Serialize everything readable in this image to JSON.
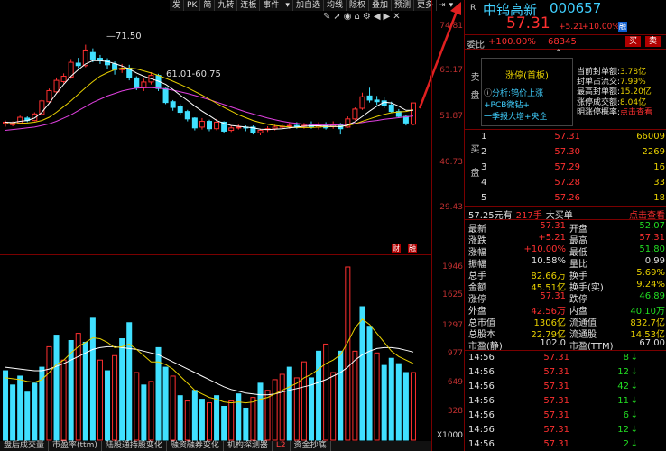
{
  "toolbar": {
    "items": [
      "发",
      "PK",
      "简",
      "九转",
      "连板",
      "事件",
      "▾",
      "加自选",
      "均线",
      "除权",
      "叠加",
      "预测",
      "更多",
      "⇥",
      "▾"
    ],
    "icons": [
      "tool-icon",
      "arrow-icon",
      "eye-icon",
      "home-icon",
      "gear-icon",
      "back-icon",
      "forward-icon",
      "close-icon"
    ]
  },
  "price_axis": [
    "74.81",
    "63.17",
    "51.87",
    "40.73",
    "29.43"
  ],
  "vol_axis": [
    "1946",
    "1625",
    "1297",
    "977",
    "649",
    "328",
    "X1000"
  ],
  "annotations": {
    "high": "71.50",
    "range": "61.01-60.75"
  },
  "bottom_tabs": [
    "盘后成交量",
    "市盈率(ttm)",
    "陆股通持股变化",
    "融资融券变化",
    "机构探测器",
    "L2",
    "资金抄底"
  ],
  "stock": {
    "name": "中钨高新",
    "code": "000657",
    "price": "57.31",
    "change": "+5.21",
    "pct": "+10.00%",
    "badge": "融",
    "r_label": "R",
    "weibi_label": "委比",
    "weibi_val": "+100.00%",
    "weicha": "68345",
    "buy": "买",
    "sell": "卖"
  },
  "limit": {
    "title": "涨停(首板)",
    "analysis_label": "分析:",
    "analysis_text": "钨价上涨",
    "tags": "+PCB微钻+",
    "tags2": "一季报大增+央企",
    "side_label": "卖盘",
    "stats": [
      {
        "k": "当前封单额:",
        "v": "3.78亿"
      },
      {
        "k": "封单占流交:",
        "v": "7.99%"
      },
      {
        "k": "最高封单额:",
        "v": "15.20亿"
      },
      {
        "k": "涨停成交额:",
        "v": "8.04亿"
      },
      {
        "k": "明涨停概率:",
        "v": "点击查看"
      }
    ]
  },
  "bids": {
    "label": "买盘",
    "rows": [
      {
        "lv": "1",
        "p": "57.31",
        "q": "66009"
      },
      {
        "lv": "2",
        "p": "57.30",
        "q": "2269"
      },
      {
        "lv": "3",
        "p": "57.29",
        "q": "16"
      },
      {
        "lv": "4",
        "p": "57.28",
        "q": "33"
      },
      {
        "lv": "5",
        "p": "57.26",
        "q": "18"
      }
    ]
  },
  "bigbuy": {
    "left": "57.25元有",
    "mid": "217手",
    "mid2": "大买单",
    "right": "点击查看"
  },
  "quote": [
    {
      "k1": "最新",
      "v1": "57.31",
      "k2": "开盘",
      "v2": "52.07"
    },
    {
      "k1": "涨跌",
      "v1": "+5.21",
      "k2": "最高",
      "v2": "57.31"
    },
    {
      "k1": "涨幅",
      "v1": "+10.00%",
      "k2": "最低",
      "v2": "51.80"
    },
    {
      "k1": "振幅",
      "v1": "10.58%",
      "k2": "量比",
      "v2": "0.99"
    },
    {
      "k1": "总手",
      "v1": "82.66万",
      "k2": "换手",
      "v2": "5.69%"
    },
    {
      "k1": "金额",
      "v1": "45.51亿",
      "k2": "换手(实)",
      "v2": "9.24%"
    },
    {
      "k1": "涨停",
      "v1": "57.31",
      "k2": "跌停",
      "v2": "46.89"
    },
    {
      "k1": "外盘",
      "v1": "42.56万",
      "k2": "内盘",
      "v2": "40.10万"
    },
    {
      "k1": "总市值",
      "v1": "1306亿",
      "k2": "流通值",
      "v2": "832.7亿"
    },
    {
      "k1": "总股本",
      "v1": "22.79亿",
      "k2": "流通股",
      "v2": "14.53亿"
    },
    {
      "k1": "市盈(静)",
      "v1": "102.0",
      "k2": "市盈(TTM)",
      "v2": "67.00"
    }
  ],
  "ticks": [
    {
      "t": "14:56",
      "p": "57.31",
      "q": "8",
      "d": "↓"
    },
    {
      "t": "14:56",
      "p": "57.31",
      "q": "12",
      "d": "↓"
    },
    {
      "t": "14:56",
      "p": "57.31",
      "q": "42",
      "d": "↓"
    },
    {
      "t": "14:56",
      "p": "57.31",
      "q": "11",
      "d": "↓"
    },
    {
      "t": "14:56",
      "p": "57.31",
      "q": "6",
      "d": "↓"
    },
    {
      "t": "14:56",
      "p": "57.31",
      "q": "12",
      "d": "↓"
    },
    {
      "t": "14:56",
      "p": "57.31",
      "q": "2",
      "d": "↓"
    }
  ],
  "chart_data": {
    "type": "candlestick",
    "ylim": [
      23,
      78
    ],
    "candles": [
      {
        "o": 52.3,
        "c": 52.6,
        "h": 53.0,
        "l": 51.5
      },
      {
        "o": 52.0,
        "c": 52.4,
        "h": 52.8,
        "l": 51.6
      },
      {
        "o": 52.4,
        "c": 53.8,
        "h": 54.2,
        "l": 52.1
      },
      {
        "o": 53.6,
        "c": 53.0,
        "h": 54.0,
        "l": 52.6
      },
      {
        "o": 53.0,
        "c": 54.6,
        "h": 55.0,
        "l": 52.8
      },
      {
        "o": 54.5,
        "c": 57.8,
        "h": 58.2,
        "l": 54.2
      },
      {
        "o": 57.6,
        "c": 60.3,
        "h": 60.8,
        "l": 57.2
      },
      {
        "o": 60.0,
        "c": 62.8,
        "h": 63.5,
        "l": 59.7
      },
      {
        "o": 62.5,
        "c": 63.8,
        "h": 64.5,
        "l": 62.0
      },
      {
        "o": 63.6,
        "c": 67.2,
        "h": 68.0,
        "l": 63.2
      },
      {
        "o": 67.0,
        "c": 66.4,
        "h": 68.3,
        "l": 65.8
      },
      {
        "o": 66.4,
        "c": 70.2,
        "h": 71.5,
        "l": 66.0
      },
      {
        "o": 69.6,
        "c": 68.0,
        "h": 70.6,
        "l": 67.2
      },
      {
        "o": 68.2,
        "c": 67.6,
        "h": 69.0,
        "l": 66.8
      },
      {
        "o": 67.6,
        "c": 66.6,
        "h": 68.2,
        "l": 65.6
      },
      {
        "o": 66.8,
        "c": 65.4,
        "h": 67.4,
        "l": 64.2
      },
      {
        "o": 65.4,
        "c": 65.7,
        "h": 66.8,
        "l": 64.6
      },
      {
        "o": 65.8,
        "c": 63.4,
        "h": 66.6,
        "l": 62.8
      },
      {
        "o": 63.4,
        "c": 61.0,
        "h": 63.8,
        "l": 60.4
      },
      {
        "o": 61.0,
        "c": 62.4,
        "h": 63.2,
        "l": 60.2
      },
      {
        "o": 62.4,
        "c": 64.0,
        "h": 64.8,
        "l": 61.8
      },
      {
        "o": 64.0,
        "c": 60.8,
        "h": 64.4,
        "l": 60.2
      },
      {
        "o": 60.8,
        "c": 57.4,
        "h": 61.0,
        "l": 57.0
      },
      {
        "o": 57.6,
        "c": 56.2,
        "h": 58.0,
        "l": 55.4
      },
      {
        "o": 56.4,
        "c": 55.0,
        "h": 57.0,
        "l": 54.4
      },
      {
        "o": 55.2,
        "c": 53.4,
        "h": 55.6,
        "l": 52.8
      },
      {
        "o": 53.6,
        "c": 51.2,
        "h": 53.8,
        "l": 50.6
      },
      {
        "o": 51.4,
        "c": 52.8,
        "h": 53.6,
        "l": 50.8
      },
      {
        "o": 52.8,
        "c": 51.0,
        "h": 53.2,
        "l": 50.4
      },
      {
        "o": 51.0,
        "c": 52.6,
        "h": 53.4,
        "l": 50.6
      },
      {
        "o": 52.6,
        "c": 50.4,
        "h": 52.8,
        "l": 50.0
      },
      {
        "o": 50.6,
        "c": 51.2,
        "h": 51.8,
        "l": 50.2
      },
      {
        "o": 51.2,
        "c": 51.4,
        "h": 52.0,
        "l": 50.8
      },
      {
        "o": 51.4,
        "c": 51.2,
        "h": 51.8,
        "l": 50.4
      },
      {
        "o": 51.4,
        "c": 50.0,
        "h": 51.8,
        "l": 49.6
      },
      {
        "o": 50.0,
        "c": 50.6,
        "h": 51.0,
        "l": 49.4
      },
      {
        "o": 50.8,
        "c": 51.0,
        "h": 51.6,
        "l": 50.2
      },
      {
        "o": 51.0,
        "c": 51.4,
        "h": 52.0,
        "l": 50.6
      },
      {
        "o": 51.4,
        "c": 51.6,
        "h": 52.2,
        "l": 51.0
      },
      {
        "o": 51.6,
        "c": 51.8,
        "h": 52.4,
        "l": 51.0
      },
      {
        "o": 51.8,
        "c": 51.6,
        "h": 52.6,
        "l": 51.0
      },
      {
        "o": 51.6,
        "c": 51.8,
        "h": 52.4,
        "l": 51.0
      },
      {
        "o": 51.8,
        "c": 51.4,
        "h": 52.8,
        "l": 51.0
      },
      {
        "o": 51.4,
        "c": 51.8,
        "h": 52.6,
        "l": 50.8
      },
      {
        "o": 51.8,
        "c": 51.2,
        "h": 52.6,
        "l": 50.8
      },
      {
        "o": 51.6,
        "c": 52.0,
        "h": 52.8,
        "l": 51.0
      },
      {
        "o": 52.0,
        "c": 51.0,
        "h": 52.4,
        "l": 49.6
      },
      {
        "o": 51.4,
        "c": 53.4,
        "h": 54.0,
        "l": 51.2
      },
      {
        "o": 53.4,
        "c": 55.8,
        "h": 56.2,
        "l": 53.0
      },
      {
        "o": 56.0,
        "c": 58.8,
        "h": 59.8,
        "l": 55.6
      },
      {
        "o": 59.0,
        "c": 58.0,
        "h": 61.0,
        "l": 57.4
      },
      {
        "o": 58.0,
        "c": 57.6,
        "h": 59.0,
        "l": 56.8
      },
      {
        "o": 57.8,
        "c": 56.6,
        "h": 58.8,
        "l": 56.0
      },
      {
        "o": 56.8,
        "c": 55.2,
        "h": 57.6,
        "l": 54.8
      },
      {
        "o": 55.2,
        "c": 54.0,
        "h": 55.8,
        "l": 53.6
      },
      {
        "o": 54.0,
        "c": 52.4,
        "h": 54.4,
        "l": 51.8
      },
      {
        "o": 52.1,
        "c": 57.3,
        "h": 57.3,
        "l": 51.8
      }
    ],
    "ma_white": [
      52.6,
      52.5,
      52.8,
      53.0,
      53.6,
      55.0,
      57.2,
      59.6,
      61.8,
      63.8,
      65.4,
      66.8,
      67.6,
      67.6,
      67.4,
      66.9,
      66.3,
      65.6,
      64.6,
      63.8,
      63.2,
      62.6,
      61.8,
      60.6,
      59.2,
      57.9,
      56.5,
      55.3,
      54.2,
      53.0,
      52.3,
      51.8,
      51.6,
      51.4,
      51.2,
      50.9,
      50.8,
      50.9,
      51.0,
      51.2,
      51.4,
      51.6,
      51.7,
      51.7,
      51.6,
      51.6,
      51.5,
      51.9,
      52.7,
      54.0,
      55.3,
      56.5,
      57.5,
      57.3,
      56.5,
      55.5,
      55.5
    ],
    "ma_yellow": [
      52.2,
      52.2,
      52.3,
      52.4,
      52.6,
      53.0,
      53.8,
      55.0,
      56.4,
      57.8,
      59.4,
      61.0,
      62.5,
      63.8,
      64.7,
      65.4,
      65.8,
      65.8,
      65.6,
      65.1,
      64.6,
      64.0,
      63.3,
      62.6,
      61.8,
      61.0,
      60.1,
      59.2,
      58.2,
      57.2,
      56.2,
      55.3,
      54.4,
      53.7,
      53.0,
      52.5,
      52.1,
      51.8,
      51.6,
      51.4,
      51.3,
      51.3,
      51.3,
      51.4,
      51.5,
      51.5,
      51.6,
      51.8,
      52.2,
      52.8,
      53.4,
      54.0,
      54.5,
      54.9,
      55.1,
      55.2,
      55.6
    ],
    "ma_magenta": [
      50.6,
      50.8,
      51.0,
      51.2,
      51.4,
      51.8,
      52.2,
      52.8,
      53.6,
      54.4,
      55.4,
      56.4,
      57.4,
      58.2,
      59.0,
      59.6,
      60.2,
      60.6,
      60.9,
      61.0,
      61.0,
      60.9,
      60.7,
      60.4,
      60.0,
      59.6,
      59.1,
      58.6,
      58.1,
      57.5,
      56.9,
      56.3,
      55.7,
      55.1,
      54.6,
      54.1,
      53.6,
      53.2,
      52.8,
      52.5,
      52.3,
      52.1,
      52.0,
      51.9,
      51.9,
      51.9,
      52.0,
      52.1,
      52.3,
      52.5,
      52.8,
      53.0,
      53.3,
      53.5,
      53.7,
      53.9,
      54.1
    ],
    "volumes": [
      [
        780,
        "c"
      ],
      [
        620,
        "c"
      ],
      [
        720,
        "c"
      ],
      [
        540,
        "c"
      ],
      [
        640,
        "c"
      ],
      [
        820,
        "c"
      ],
      [
        1050,
        "r"
      ],
      [
        1180,
        "c"
      ],
      [
        900,
        "r"
      ],
      [
        1120,
        "c"
      ],
      [
        1200,
        "r"
      ],
      [
        1100,
        "c"
      ],
      [
        1380,
        "c"
      ],
      [
        900,
        "r"
      ],
      [
        780,
        "c"
      ],
      [
        950,
        "r"
      ],
      [
        1140,
        "c"
      ],
      [
        1320,
        "c"
      ],
      [
        760,
        "r"
      ],
      [
        620,
        "c"
      ],
      [
        660,
        "r"
      ],
      [
        1040,
        "c"
      ],
      [
        820,
        "c"
      ],
      [
        720,
        "r"
      ],
      [
        500,
        "c"
      ],
      [
        440,
        "r"
      ],
      [
        560,
        "c"
      ],
      [
        460,
        "c"
      ],
      [
        420,
        "r"
      ],
      [
        500,
        "c"
      ],
      [
        380,
        "c"
      ],
      [
        440,
        "r"
      ],
      [
        520,
        "c"
      ],
      [
        360,
        "c"
      ],
      [
        480,
        "r"
      ],
      [
        640,
        "c"
      ],
      [
        560,
        "r"
      ],
      [
        680,
        "r"
      ],
      [
        740,
        "r"
      ],
      [
        820,
        "c"
      ],
      [
        700,
        "r"
      ],
      [
        880,
        "r"
      ],
      [
        700,
        "c"
      ],
      [
        1000,
        "c"
      ],
      [
        1080,
        "r"
      ],
      [
        760,
        "r"
      ],
      [
        1000,
        "c"
      ],
      [
        1946,
        "r"
      ],
      [
        1000,
        "r"
      ],
      [
        1500,
        "c"
      ],
      [
        1280,
        "c"
      ],
      [
        980,
        "r"
      ],
      [
        840,
        "c"
      ],
      [
        920,
        "c"
      ],
      [
        860,
        "c"
      ],
      [
        760,
        "c"
      ],
      [
        760,
        "r"
      ]
    ],
    "vol_ma_yellow": [
      700,
      690,
      680,
      660,
      650,
      680,
      760,
      850,
      900,
      980,
      1050,
      1100,
      1150,
      1140,
      1100,
      1040,
      1050,
      1080,
      1020,
      950,
      880,
      880,
      850,
      800,
      720,
      640,
      560,
      520,
      480,
      460,
      430,
      420,
      430,
      420,
      430,
      460,
      480,
      520,
      560,
      600,
      640,
      700,
      740,
      800,
      860,
      900,
      960,
      1100,
      1260,
      1360,
      1300,
      1200,
      1100,
      1000,
      940,
      900,
      860
    ],
    "vol_ma_white": [
      820,
      810,
      800,
      790,
      780,
      780,
      800,
      830,
      860,
      900,
      940,
      980,
      1020,
      1040,
      1050,
      1050,
      1040,
      1030,
      1020,
      1000,
      980,
      960,
      920,
      880,
      840,
      800,
      760,
      720,
      680,
      640,
      600,
      570,
      550,
      530,
      520,
      510,
      510,
      520,
      540,
      560,
      580,
      600,
      620,
      650,
      680,
      720,
      760,
      820,
      900,
      960,
      1000,
      1030,
      1040,
      1040,
      1030,
      1010,
      990
    ],
    "vol_max": 1946
  }
}
